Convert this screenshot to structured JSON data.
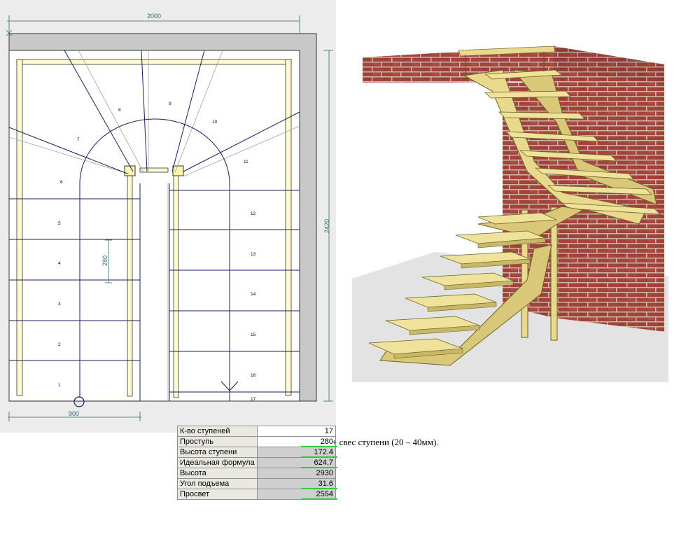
{
  "plan": {
    "dim_width": "2000",
    "dim_height": "2420",
    "dim_flight_width": "900",
    "dim_tread": "280",
    "step_numbers": [
      "1",
      "2",
      "3",
      "4",
      "5",
      "6",
      "7",
      "8",
      "9",
      "10",
      "11",
      "12",
      "13",
      "14",
      "15",
      "16",
      "17"
    ]
  },
  "params": {
    "rows": [
      {
        "label": "К-во ступеней",
        "value": "17"
      },
      {
        "label": "Проступь",
        "value": "280"
      },
      {
        "label": "Высота ступени",
        "value": "172.4"
      },
      {
        "label": "Идеальная формула",
        "value": "624.7"
      },
      {
        "label": "Высота",
        "value": "2930"
      },
      {
        "label": "Угол подъема",
        "value": "31.6"
      },
      {
        "label": "Просвет",
        "value": "2554"
      }
    ],
    "note": "+ свес ступени (20 – 40мм)."
  },
  "colors": {
    "dimension": "#2c6d6d",
    "stringer": "#fffbd0",
    "wood": "#e8d98c",
    "brick": "#a4433a",
    "underline": "#33cc33"
  }
}
